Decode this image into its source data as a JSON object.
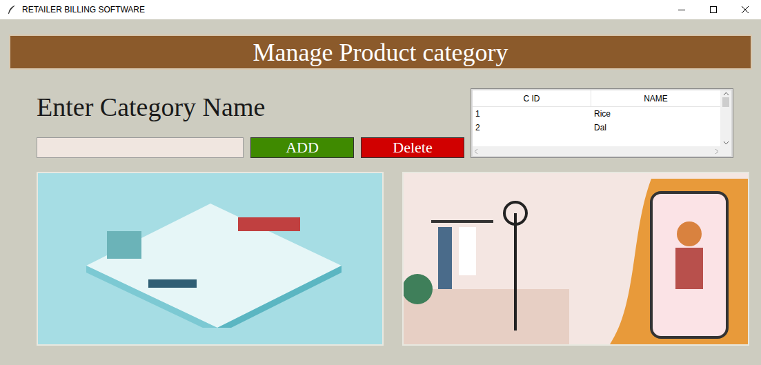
{
  "window": {
    "title": "RETAILER BILLING SOFTWARE"
  },
  "header": {
    "title": "Manage Product category"
  },
  "form": {
    "label": "Enter Category Name",
    "value": ""
  },
  "buttons": [
    {
      "label": "ADD",
      "color": "#3f8a00"
    },
    {
      "label": "Delete",
      "color": "#d10000"
    }
  ],
  "table": {
    "columns": [
      "C ID",
      "NAME"
    ],
    "rows": [
      {
        "cells": [
          "1",
          "Rice"
        ],
        "selected": false
      },
      {
        "cells": [
          "2",
          "Dal"
        ],
        "selected": false
      }
    ]
  }
}
